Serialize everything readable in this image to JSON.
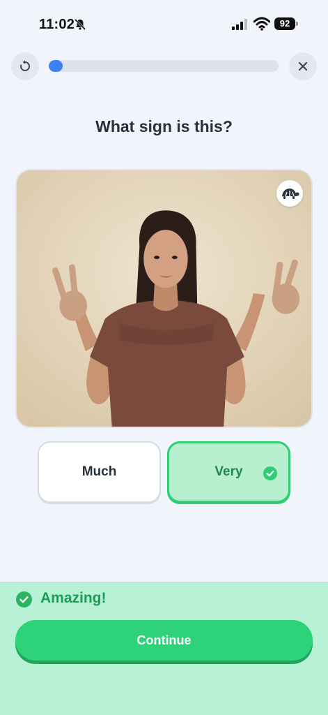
{
  "status_bar": {
    "time": "11:02",
    "battery": "92",
    "icons": [
      "bell-muted-icon",
      "signal-icon",
      "wifi-icon",
      "battery-icon"
    ]
  },
  "top_bar": {
    "left_icon": "restart-icon",
    "right_icon": "close-icon",
    "progress_fraction": 0.05
  },
  "question": "What sign is this?",
  "video": {
    "slow_button_icon": "turtle-icon"
  },
  "options": [
    {
      "label": "Much",
      "selected": false
    },
    {
      "label": "Very",
      "selected": true,
      "correct": true
    }
  ],
  "feedback": {
    "text": "Amazing!",
    "button_label": "Continue",
    "colors": {
      "panel": "#b8f2d6",
      "accent": "#2ed379"
    }
  }
}
